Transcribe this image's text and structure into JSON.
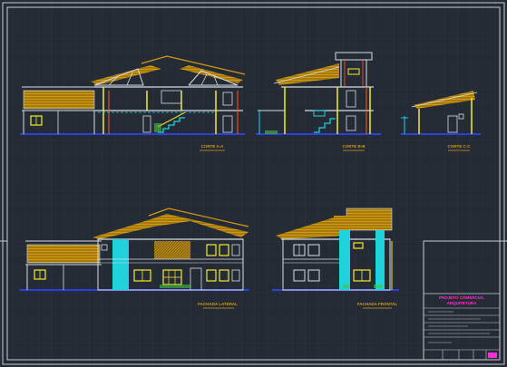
{
  "drawing": {
    "section_labels": [
      "CORTE A-A",
      "CORTE B-B",
      "CORTE C-C"
    ],
    "facade_labels": [
      "FACHADA LATERAL",
      "FACHADA FRONTAL"
    ]
  },
  "title_block": {
    "project_title_line1": "PROJETO COMERCIAL",
    "project_title_line2": "ARQUITETURA"
  },
  "colors": {
    "background": "#242b35",
    "grid": "#2f3843",
    "frame": "#c8ccd2",
    "roof": "#b8860b",
    "wall": "#d8dde5",
    "window": "#f2ec2c",
    "ground": "#2d3fe0",
    "cyan": "#1fd2dc",
    "label": "#d49a17",
    "title_text": "#ff2fd6"
  }
}
